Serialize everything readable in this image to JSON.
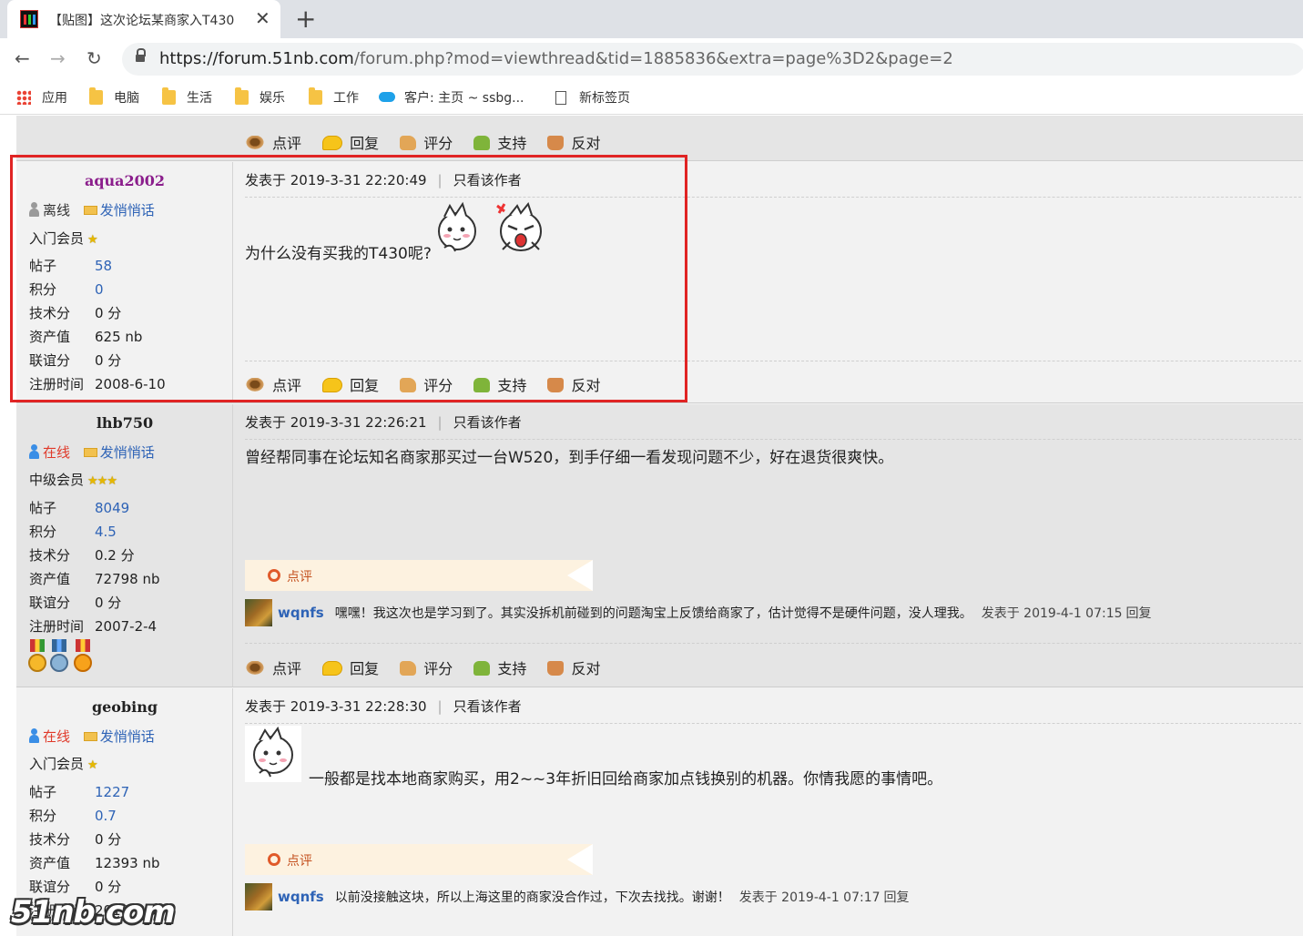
{
  "browser": {
    "tab_title": "【贴图】这次论坛某商家入T430",
    "close_glyph": "✕",
    "newtab_glyph": "+",
    "url_host": "https://forum.51nb.com",
    "url_path": "/forum.php?mod=viewthread&tid=1885836&extra=page%3D2&page=2",
    "back_glyph": "←",
    "forward_glyph": "→",
    "reload_glyph": "↻",
    "bookmarks": [
      {
        "label": "应用",
        "icon": "apps-grid-icon"
      },
      {
        "label": "电脑",
        "icon": "folder-icon"
      },
      {
        "label": "生活",
        "icon": "folder-icon"
      },
      {
        "label": "娱乐",
        "icon": "folder-icon"
      },
      {
        "label": "工作",
        "icon": "folder-icon"
      },
      {
        "label": "客户: 主页 ~ ssbg...",
        "icon": "salesforce-cloud-icon"
      },
      {
        "label": "新标签页",
        "icon": "page-icon"
      }
    ]
  },
  "actions": {
    "comment": "点评",
    "reply": "回复",
    "rate": "评分",
    "support": "支持",
    "oppose": "反对"
  },
  "labels": {
    "posts": "帖子",
    "points": "积分",
    "tech": "技术分",
    "assets": "资产值",
    "friendship": "联谊分",
    "registered": "注册时间",
    "send_pm": "发悄悄话",
    "only_author": "只看该作者",
    "separator": "|",
    "comment_header": "点评",
    "reply_btn": "回复"
  },
  "posts": [
    {
      "author": "aqua2002",
      "status": "离线",
      "rank": "入门会员",
      "stars": "★",
      "stats": {
        "posts": "58",
        "points": "0",
        "tech": "0 分",
        "assets": "625 nb",
        "friendship": "0 分",
        "registered": "2008-6-10"
      },
      "posted": "发表于 2019-3-31 22:20:49",
      "body": "为什么没有买我的T430呢?"
    },
    {
      "author": "lhb750",
      "status": "在线",
      "rank": "中级会员",
      "stars": "★★★",
      "stats": {
        "posts": "8049",
        "points": "4.5",
        "tech": "0.2 分",
        "assets": "72798 nb",
        "friendship": "0 分",
        "registered": "2007-2-4"
      },
      "posted": "发表于 2019-3-31 22:26:21",
      "body": "曾经帮同事在论坛知名商家那买过一台W520，到手仔细一看发现问题不少，好在退货很爽快。",
      "comment": {
        "user": "wqnfs",
        "text": "嘿嘿！我这次也是学习到了。其实没拆机前碰到的问题淘宝上反馈给商家了，估计觉得不是硬件问题，没人理我。",
        "time": "发表于 2019-4-1 07:15"
      }
    },
    {
      "author": "geobing",
      "status": "在线",
      "rank": "入门会员",
      "stars": "★",
      "stats": {
        "posts": "1227",
        "points": "0.7",
        "tech": "0 分",
        "assets": "12393 nb",
        "friendship": "0 分",
        "registered": "2010-8-30"
      },
      "posted": "发表于 2019-3-31 22:28:30",
      "body": "一般都是找本地商家购买，用2~~3年折旧回给商家加点钱换别的机器。你情我愿的事情吧。",
      "comment": {
        "user": "wqnfs",
        "text": "以前没接触这块，所以上海这里的商家没合作过，下次去找找。谢谢！",
        "time": "发表于 2019-4-1 07:17"
      }
    }
  ],
  "watermark": "51nb.com",
  "colors": {
    "highlight_box": "#e02424",
    "author_highlight": "#8b1e8c",
    "link_blue": "#2e63b6",
    "online_red": "#e03a2a",
    "comment_bg": "#fdf2e0"
  }
}
